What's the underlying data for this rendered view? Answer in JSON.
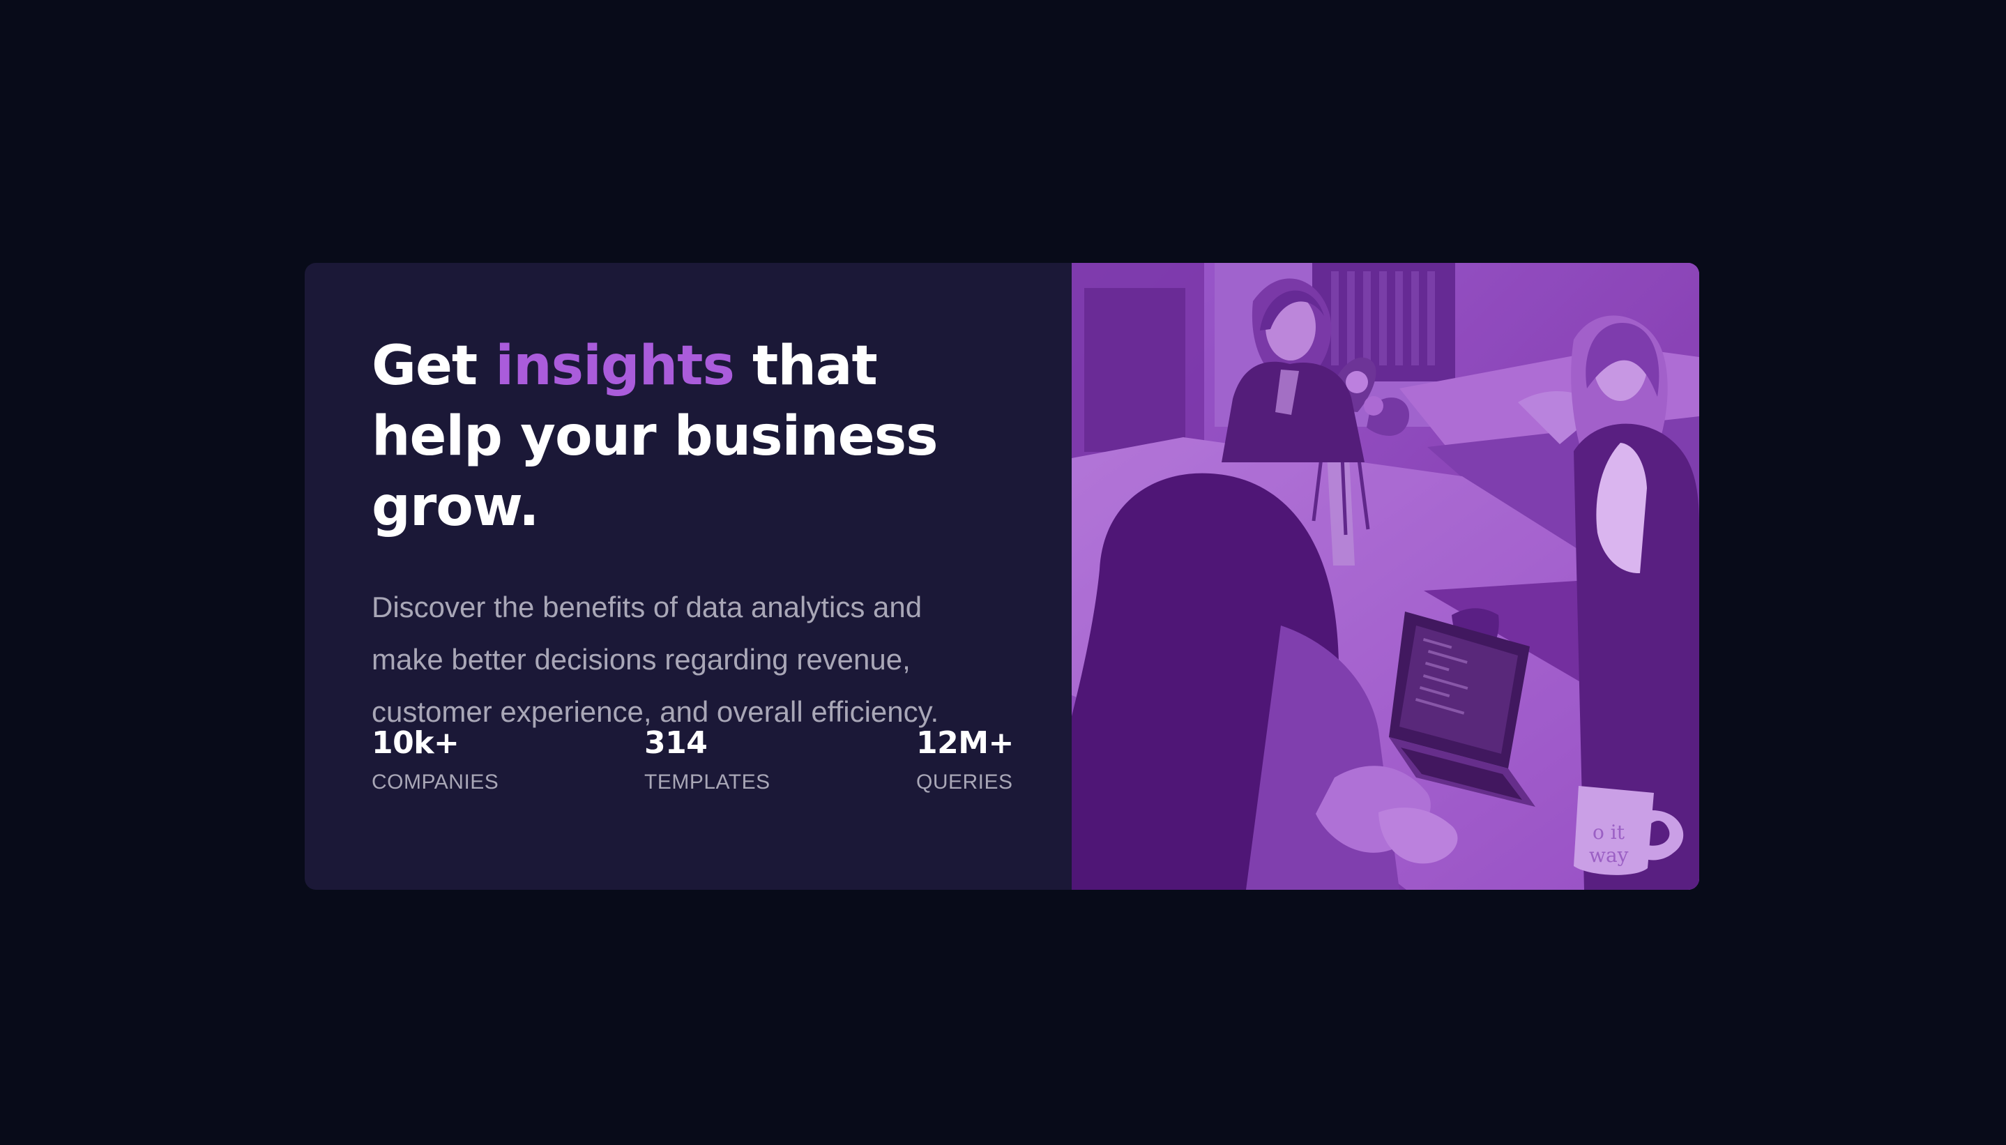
{
  "hero": {
    "headline_prefix": "Get ",
    "headline_accent": "insights",
    "headline_suffix": " that help your business grow.",
    "description": "Discover the benefits of data analytics and make better decisions regarding revenue, customer experience, and overall efficiency."
  },
  "stats": [
    {
      "value": "10k+",
      "label": "COMPANIES"
    },
    {
      "value": "314",
      "label": "TEMPLATES"
    },
    {
      "value": "12M+",
      "label": "QUERIES"
    }
  ],
  "image": {
    "mug_text_line1": "o it",
    "mug_text_line2": "way"
  },
  "colors": {
    "page_background": "#080b19",
    "card_background": "#1b1837",
    "accent": "#aa5cdb",
    "heading_text": "#ffffff",
    "body_text": "#a9a7b7",
    "image_overlay": "#8a45b3"
  }
}
